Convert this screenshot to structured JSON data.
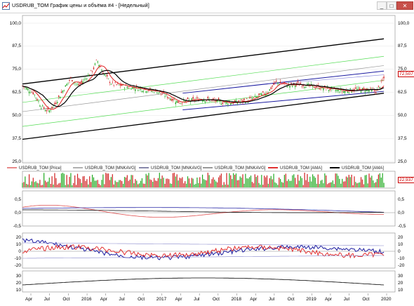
{
  "window": {
    "title": "USDRUB_TOM График цены и объёма #4 - [Недельный]",
    "min_label": "_",
    "max_label": "□",
    "close_label": "✕"
  },
  "price_axis": {
    "ticks": [
      "100,0",
      "87,5",
      "75,0",
      "62,5",
      "50,0",
      "37,5",
      "25,0"
    ],
    "current_price": "72,507"
  },
  "legend": [
    {
      "label": "USDRUB_TOM [Price]",
      "color": "#e88a8a"
    },
    {
      "label": "USDRUB_TOM [MNKAVG]",
      "color": "#b0b0b0"
    },
    {
      "label": "USDRUB_TOM [MNKAVG]",
      "color": "#8888aa"
    },
    {
      "label": "USDRUB_TOM [MNKAVG]",
      "color": "#999999"
    },
    {
      "label": "USDRUB_TOM [AMA]",
      "color": "#e03030"
    },
    {
      "label": "USDRUB_TOM [AMA]",
      "color": "#000000"
    }
  ],
  "volume_panel": {
    "current_value": "22,937"
  },
  "osc1_ticks": [
    "0,5",
    "0,0",
    "-0,5"
  ],
  "osc2_ticks": [
    "20",
    "10",
    "0",
    "-10",
    "-20"
  ],
  "osc3_ticks": [
    "30",
    "20",
    "10"
  ],
  "x_axis": [
    "Apr",
    "Jul",
    "Oct",
    "2016",
    "Apr",
    "Jul",
    "Oct",
    "2017",
    "Apr",
    "Jul",
    "Oct",
    "2018",
    "Apr",
    "Jul",
    "Oct",
    "2019",
    "Apr",
    "Jul",
    "Oct",
    "2020"
  ],
  "icons": {
    "app": "chart-app-icon"
  }
}
